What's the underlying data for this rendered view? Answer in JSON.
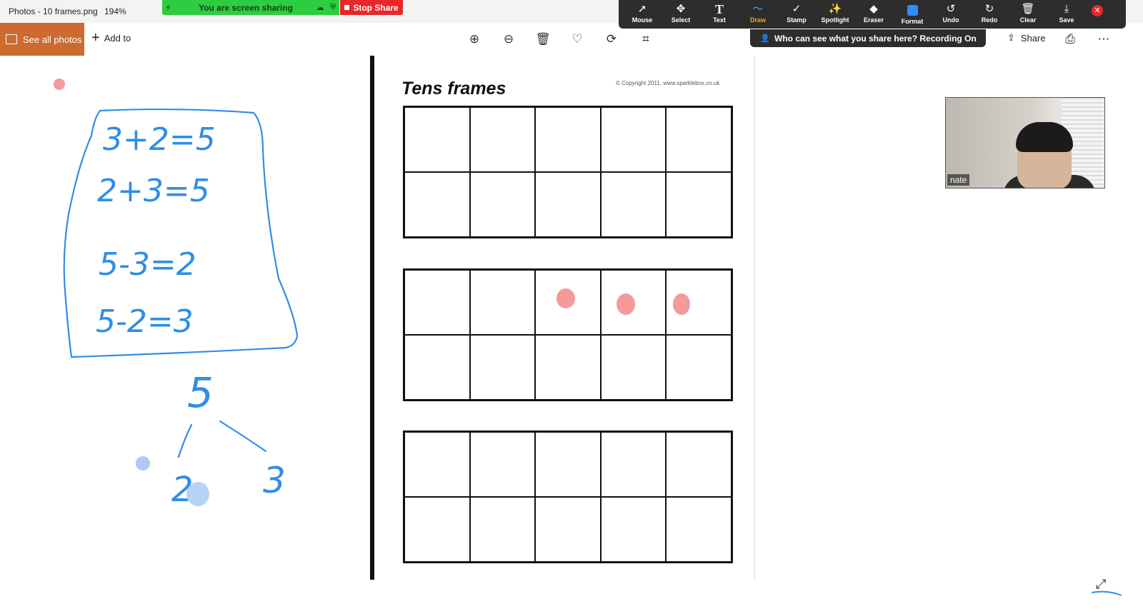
{
  "titlebar": {
    "app_title": "Photos - 10 frames.png",
    "zoom": "194%"
  },
  "zoom_share": {
    "banner_text": "You are screen sharing",
    "stop_label": "Stop Share",
    "recording_notice": "Who can see what you share here? Recording On"
  },
  "annotation_tools": [
    {
      "label": "Mouse",
      "icon": "cursor-icon"
    },
    {
      "label": "Select",
      "icon": "move-icon"
    },
    {
      "label": "Text",
      "icon": "text-icon"
    },
    {
      "label": "Draw",
      "icon": "draw-icon",
      "active": true
    },
    {
      "label": "Stamp",
      "icon": "check-icon"
    },
    {
      "label": "Spotlight",
      "icon": "wand-icon"
    },
    {
      "label": "Eraser",
      "icon": "eraser-icon"
    },
    {
      "label": "Format",
      "icon": "format-icon"
    },
    {
      "label": "Undo",
      "icon": "undo-icon"
    },
    {
      "label": "Redo",
      "icon": "redo-icon"
    },
    {
      "label": "Clear",
      "icon": "trash-icon"
    },
    {
      "label": "Save",
      "icon": "download-icon"
    }
  ],
  "photos_bar": {
    "see_all_label": "See all photos",
    "add_to_label": "Add to",
    "share_label": "Share"
  },
  "worksheet": {
    "title": "Tens frames",
    "copyright": "© Copyright 2011, www.sparklebox.co.uk"
  },
  "ink_text": {
    "eq1": "3+2=5",
    "eq2": "2+3=5",
    "eq3": "5-3=2",
    "eq4": "5-2=3",
    "total": "5",
    "part_left": "2",
    "part_right": "3"
  },
  "participant": {
    "name": "nate"
  },
  "colors": {
    "ink_blue": "#2f8ee6",
    "ink_pink": "#f49a9a",
    "accent_orange": "#cc6a2f",
    "share_green": "#2ecc40",
    "stop_red": "#e8272b"
  }
}
